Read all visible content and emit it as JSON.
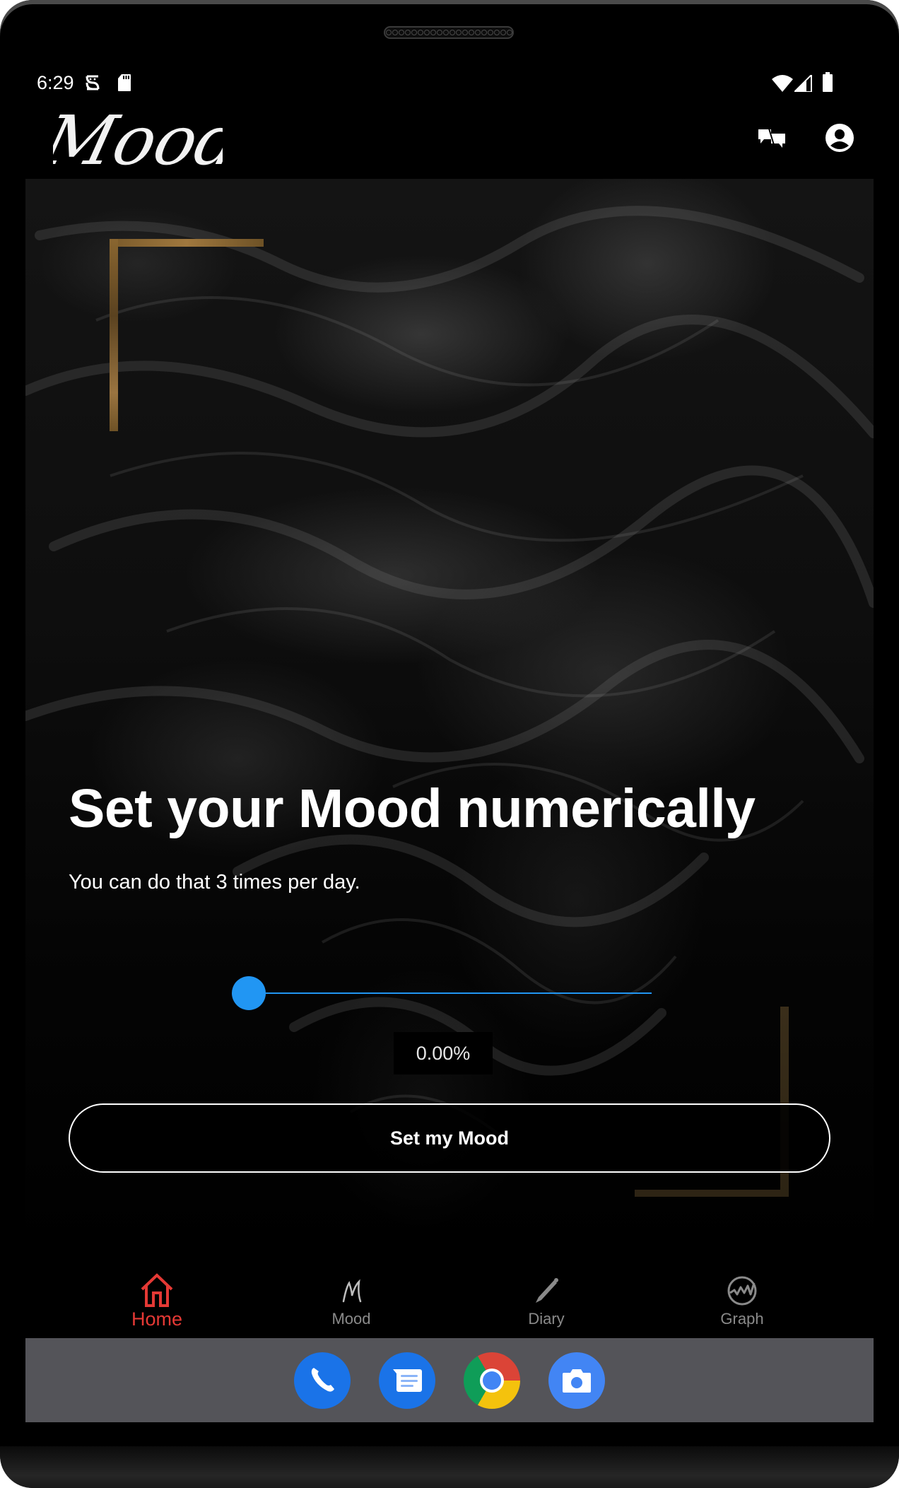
{
  "status_bar": {
    "time": "6:29",
    "left_icons": [
      "debug-icon",
      "sd-card-icon"
    ],
    "right_icons": [
      "wifi-icon",
      "cell-signal-icon",
      "battery-icon"
    ]
  },
  "app_bar": {
    "logo_text": "Mood",
    "actions": [
      {
        "name": "translate-icon",
        "label": "Language"
      },
      {
        "name": "account-icon",
        "label": "Account"
      }
    ]
  },
  "main": {
    "title": "Set your Mood numerically",
    "subtitle": "You can do that 3 times per day.",
    "slider": {
      "value": 0,
      "min": 0,
      "max": 100,
      "accent_color": "#2196F3"
    },
    "value_display": "0.00%",
    "submit_label": "Set my Mood",
    "decor_color": "#A0783E"
  },
  "bottom_nav": {
    "active_color": "#E53935",
    "inactive_color": "#8A8A8A",
    "items": [
      {
        "label": "Home",
        "icon": "home-icon",
        "active": true
      },
      {
        "label": "Mood",
        "icon": "mood-script-icon",
        "active": false
      },
      {
        "label": "Diary",
        "icon": "pencil-icon",
        "active": false
      },
      {
        "label": "Graph",
        "icon": "graph-icon",
        "active": false
      }
    ]
  },
  "dock": {
    "apps": [
      {
        "name": "Phone",
        "icon": "phone-icon"
      },
      {
        "name": "Messages",
        "icon": "messages-icon"
      },
      {
        "name": "Chrome",
        "icon": "chrome-icon"
      },
      {
        "name": "Camera",
        "icon": "camera-icon"
      }
    ]
  }
}
